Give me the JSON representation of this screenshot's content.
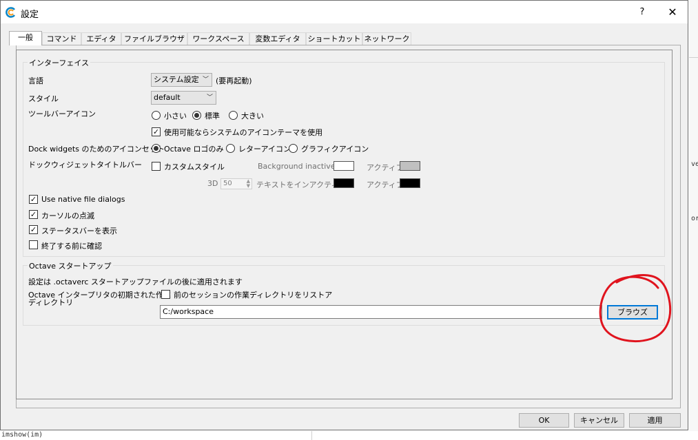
{
  "window": {
    "title": "設定",
    "help_glyph": "?",
    "close_glyph": "✕"
  },
  "tabs": [
    {
      "label": "一般",
      "active": true
    },
    {
      "label": "コマンド"
    },
    {
      "label": "エディタ"
    },
    {
      "label": "ファイルブラウザ"
    },
    {
      "label": "ワークスペース"
    },
    {
      "label": "変数エディタ"
    },
    {
      "label": "ショートカット"
    },
    {
      "label": "ネットワーク"
    }
  ],
  "interface": {
    "title": "インターフェイス",
    "language_label": "言語",
    "language_value": "システム設定",
    "language_note": "(要再起動)",
    "style_label": "スタイル",
    "style_value": "default",
    "toolbar_icons_label": "ツールバーアイコン",
    "toolbar_icon_options": [
      "小さい",
      "標準",
      "大きい"
    ],
    "toolbar_icon_selected": "標準",
    "use_system_icon_theme": "使用可能ならシステムのアイコンテーマを使用",
    "dock_icon_label": "Dock widgets のためのアイコンセット",
    "dock_icon_options": [
      "Octave ロゴのみ",
      "レターアイコン",
      "グラフィクアイコン"
    ],
    "dock_icon_selected": "Octave ロゴのみ",
    "dock_titlebar_label": "ドックウィジェットタイトルバー",
    "custom_style": "カスタムスタイル",
    "background_inactive": "Background inactive",
    "active_label": "アクティブ",
    "threed_label": "3D",
    "threed_value": "50",
    "text_inactive": "テキストをインアクティブ",
    "active_label_2": "アクティブ",
    "native_dialogs": "Use native file dialogs",
    "cursor_blink": "カーソルの点滅",
    "show_statusbar": "ステータスバーを表示",
    "confirm_exit": "終了する前に確認",
    "colors": {
      "background_inactive": "#ffffff",
      "background_active": "#c0c0c0",
      "text_inactive": "#000000",
      "text_active": "#000000"
    },
    "checked": {
      "use_system_icon_theme": true,
      "custom_style": false,
      "native_dialogs": true,
      "cursor_blink": true,
      "show_statusbar": true,
      "confirm_exit": false
    }
  },
  "startup": {
    "title": "Octave スタートアップ",
    "note": "設定は .octaverc スタートアップファイルの後に適用されます",
    "workdir_label_line1": "Octave インタープリタの初期された作業",
    "workdir_label_line2": "ディレクトリ",
    "restore_label": "前のセッションの作業ディレクトリをリストア",
    "restore_checked": false,
    "path_value": "C:/workspace",
    "browse_label": "ブラウズ"
  },
  "footer": {
    "ok": "OK",
    "cancel": "キャンセル",
    "apply": "適用"
  },
  "background_fragments": {
    "right_1": "ve",
    "right_2": "or",
    "bottom": "imshow(im)"
  },
  "accent_color": "#0078d7",
  "annotation_color": "#e0141e"
}
